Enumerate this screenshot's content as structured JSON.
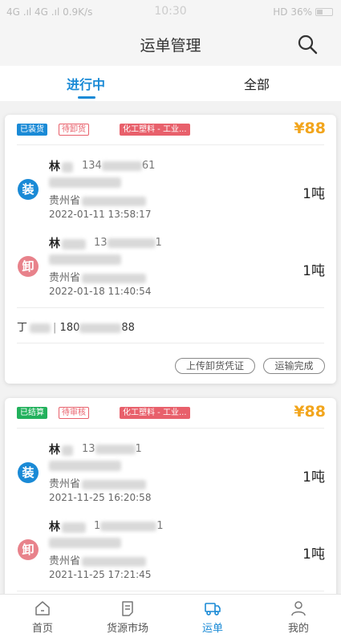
{
  "status_bar": {
    "left": "4G .ıl 4G .ıl 0.9K/s",
    "time": "10:30",
    "right": "HD 36%",
    "battery_level": 0.36
  },
  "navbar": {
    "title": "运单管理",
    "search_icon": "search-icon"
  },
  "tabs": [
    {
      "label": "进行中",
      "active": true
    },
    {
      "label": "全部",
      "active": false
    }
  ],
  "orders": [
    {
      "tags": [
        "已装货",
        "待卸货",
        "化工塑料 - 工业..."
      ],
      "price": "¥88",
      "load": {
        "icon_label": "装",
        "name": "林",
        "phone_prefix": "134",
        "phone_suffix": "61",
        "city": "贵州省",
        "time": "2022-01-11 13:58:17",
        "weight": "1吨"
      },
      "unload": {
        "icon_label": "卸",
        "name": "林",
        "phone_prefix": "13",
        "phone_suffix": "1",
        "city": "贵州省",
        "time": "2022-01-18 11:40:54",
        "weight": "1吨"
      },
      "driver": {
        "name": "丁",
        "divider": "|",
        "phone_prefix": "180",
        "phone_suffix": "88"
      },
      "buttons": [
        "上传卸货凭证",
        "运输完成"
      ]
    },
    {
      "tags": [
        "已结算",
        "待审核",
        "化工塑料 - 工业..."
      ],
      "price": "¥88",
      "load": {
        "icon_label": "装",
        "name": "林",
        "phone_prefix": "13",
        "phone_suffix": "1",
        "city": "贵州省",
        "time": "2021-11-25 16:20:58",
        "weight": "1吨"
      },
      "unload": {
        "icon_label": "卸",
        "name": "林",
        "phone_prefix": "1",
        "phone_suffix": "1",
        "city": "贵州省",
        "time": "2021-11-25 17:21:45",
        "weight": "1吨"
      }
    }
  ],
  "bottom_nav": [
    {
      "label": "首页",
      "icon": "home-icon",
      "active": false
    },
    {
      "label": "货源市场",
      "icon": "document-icon",
      "active": false
    },
    {
      "label": "运单",
      "icon": "truck-icon",
      "active": true
    },
    {
      "label": "我的",
      "icon": "person-icon",
      "active": false
    }
  ],
  "colors": {
    "accent": "#1a8ad6",
    "price": "#f2a51c",
    "tag_pink": "#e8606b",
    "tag_green": "#22b15c"
  }
}
